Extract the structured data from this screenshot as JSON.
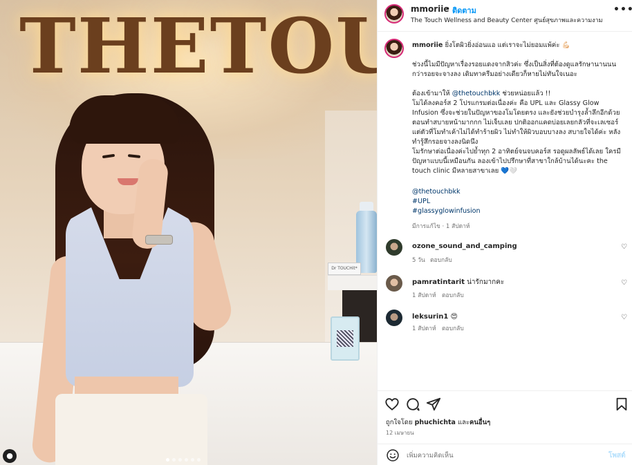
{
  "header": {
    "username": "mmoriie",
    "separator": "•",
    "follow_label": "ติดตาม",
    "location": "The Touch Wellness and Beauty Center ศูนย์สุขภาพและความงาม",
    "more_icon": "more-horizontal-icon"
  },
  "photo": {
    "sign_text": "THETOUC",
    "shelf_box_text": "Dr TOUCHit*"
  },
  "caption": {
    "username": "mmoriie",
    "line1": "ยิ่งโตผิวยิ่งอ่อนแอ แต่เราจะไม่ยอมแพ้ค่ะ 💪🏻",
    "p1": "ช่วงนี้ไมมีปัญหาเรื่องรอยแดงจากสิวค่ะ ซึ่งเป็นสิ่งที่ต้องดูแลรักษานานนน กว่ารอยจะจางลง เดิมทาครีมอย่างเดียวก็หายไม่ทันใจเนอะ",
    "p2_prefix": "ต้องเข้ามาให้",
    "p2_mention": "@thetouchbkk",
    "p2_suffix": "ช่วยหน่อยแล้ว !!",
    "p3": "โมได้ลงคอร์ส 2 โปรแกรมต่อเนื่องค่ะ คือ UPL และ Glassy Glow Infusion ซึ่งจะช่วยในปัญหาของโมโดยตรง และยังช่วยบำรุงล้ำลึกอีกด้วย ตอนทำสบายหน้ามากกก ไม่เจ็บเลย ปกติออกแคดบ่อยเลยกลัวที่จะเลเซอร์ แต่ตัวที่โมทำเค้าไม่ได้ทำร้ายผิว ไม่ทำให้ผิวบอบบางลง สบายใจได้ค่ะ หลังทำรู้สึกรอยจางลงนิดนึง",
    "p4": "โมรักษาต่อเนื่องค่ะไปย้ำทุก 2 อาทิตย์จนจบคอร์ส รอดูผลลัพธ์ได้เลย ใครมีปัญหาแบบนี้เหมือนกัน ลองเข้าไปปรึกษาที่สาขาใกล้บ้านได้นะคะ the touch clinic มีหลายสาขาเลย 💙🤍",
    "tag1": "@thetouchbkk",
    "tag2": "#UPL",
    "tag3": "#glassyglowinfusion",
    "meta": "มีการแก้ไข · 1 สัปดาห์"
  },
  "comments": [
    {
      "username": "ozone_sound_and_camping",
      "text": "",
      "time": "5 วัน",
      "reply": "ตอบกลับ"
    },
    {
      "username": "pamratintarit",
      "text": "น่ารักมากคะ",
      "time": "1 สัปดาห์",
      "reply": "ตอบกลับ"
    },
    {
      "username": "leksurin1",
      "text": "😍",
      "time": "1 สัปดาห์",
      "reply": "ตอบกลับ"
    }
  ],
  "actions": {
    "liked_by_prefix": "ถูกใจโดย",
    "liked_by_user": "phuchichta",
    "liked_by_and": "และ",
    "liked_by_others": "คนอื่นๆ",
    "date": "12 เมษายน",
    "comment_placeholder": "เพิ่มความคิดเห็น",
    "post_label": "โพสต์"
  },
  "icons": {
    "like": "heart-icon",
    "comment": "comment-icon",
    "share": "share-icon",
    "save": "bookmark-icon",
    "emoji": "emoji-icon"
  },
  "colors": {
    "link": "#00376b",
    "follow": "#0095f6",
    "post_disabled": "#b2dffc",
    "muted": "#737373"
  }
}
